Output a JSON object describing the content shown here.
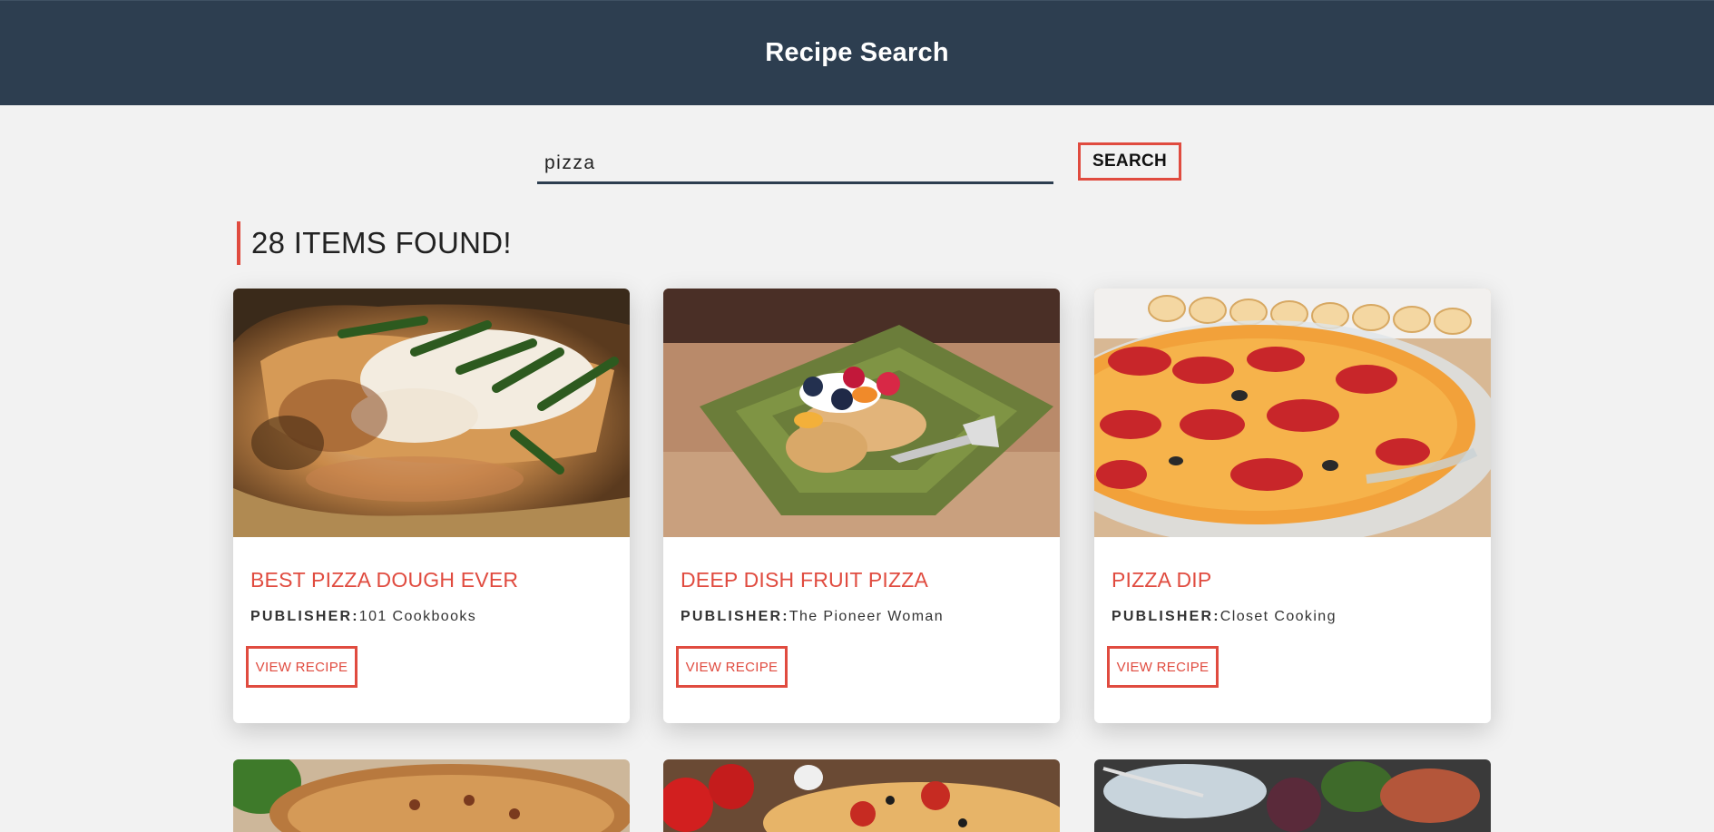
{
  "header": {
    "title": "Recipe Search"
  },
  "search": {
    "value": "pizza",
    "button_label": "SEARCH"
  },
  "results": {
    "count_text": "28 ITEMS FOUND!"
  },
  "recipes": [
    {
      "title": "BEST PIZZA DOUGH EVER",
      "publisher_label": "PUBLISHER:",
      "publisher": "101 Cookbooks",
      "button_label": "VIEW RECIPE"
    },
    {
      "title": "DEEP DISH FRUIT PIZZA",
      "publisher_label": "PUBLISHER:",
      "publisher": "The Pioneer Woman",
      "button_label": "VIEW RECIPE"
    },
    {
      "title": "PIZZA DIP",
      "publisher_label": "PUBLISHER:",
      "publisher": "Closet Cooking",
      "button_label": "VIEW RECIPE"
    }
  ],
  "colors": {
    "header_bg": "#2d3e50",
    "accent": "#e04b3f",
    "page_bg": "#f2f2f2"
  }
}
